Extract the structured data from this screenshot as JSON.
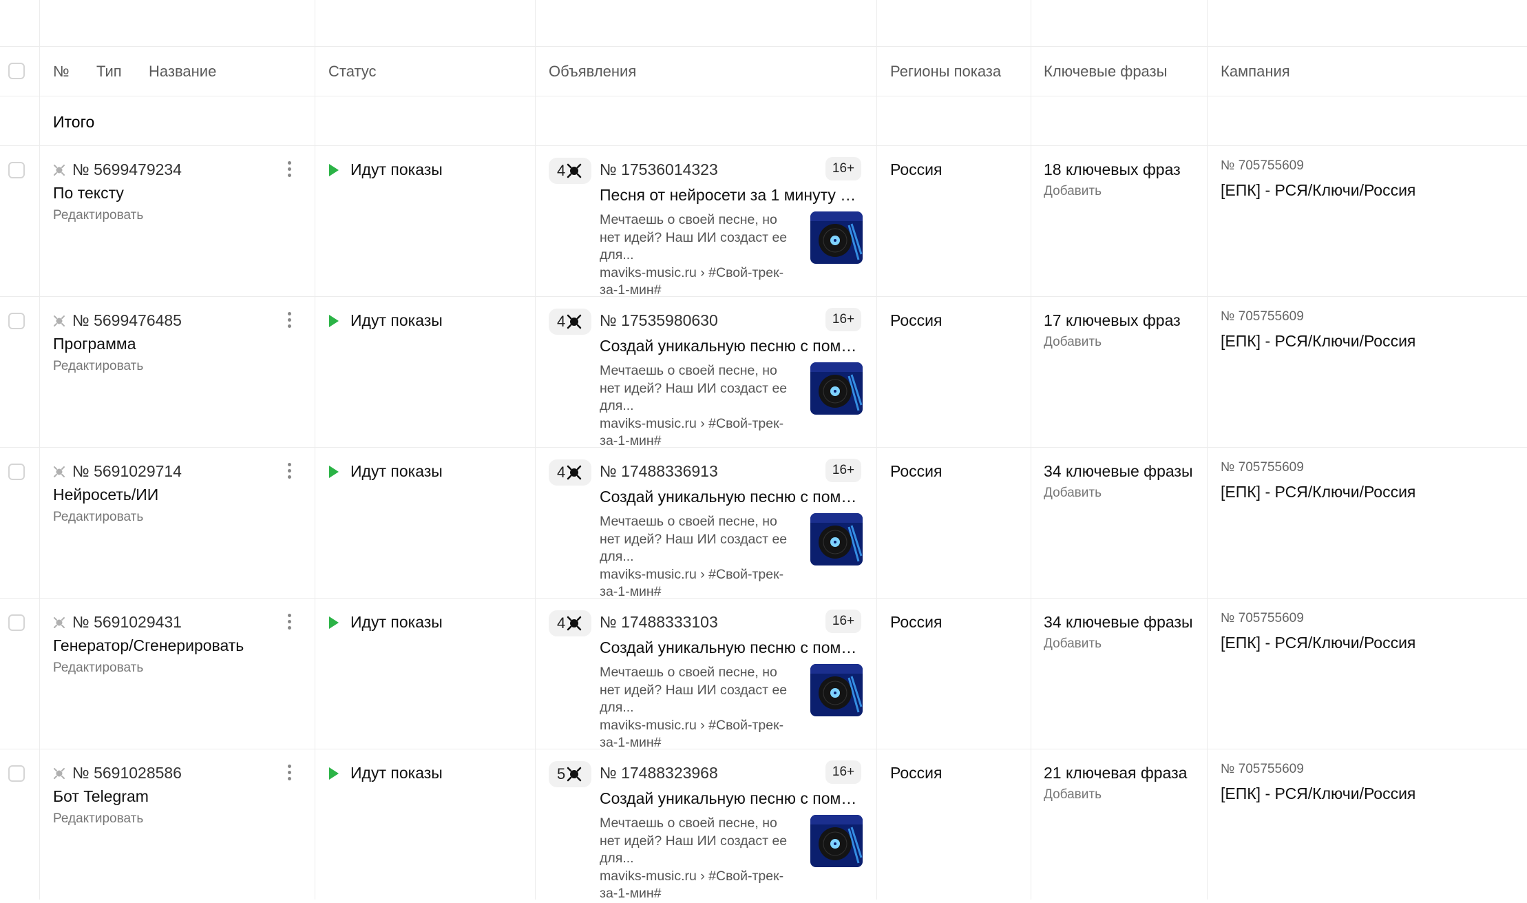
{
  "header": {
    "number": "№",
    "type": "Тип",
    "name": "Название",
    "status": "Статус",
    "ads": "Объявления",
    "regions": "Регионы показа",
    "keywords": "Ключевые фразы",
    "campaign": "Кампания"
  },
  "total_label": "Итого",
  "rows": [
    {
      "group_id": "№ 5699479234",
      "group_name": "По тексту",
      "edit_label": "Редактировать",
      "status": "Идут показы",
      "ad_count": "4",
      "ad_id": "№ 17536014323",
      "age": "16+",
      "ad_title": "Песня от нейросети за 1 минуту п...",
      "ad_desc": "Мечтаешь о своей песне, но нет идей? Наш ИИ создаст ее для...",
      "ad_link": "maviks-music.ru › #Свой-трек-за-1-мин#",
      "region": "Россия",
      "kw_count": "18 ключевых фраз",
      "kw_add": "Добавить",
      "campaign_id": "№ 705755609",
      "campaign_name": "[ЕПК] - РСЯ/Ключи/Россия"
    },
    {
      "group_id": "№ 5699476485",
      "group_name": "Программа",
      "edit_label": "Редактировать",
      "status": "Идут показы",
      "ad_count": "4",
      "ad_id": "№ 17535980630",
      "age": "16+",
      "ad_title": "Создай уникальную песню с помо...",
      "ad_desc": "Мечтаешь о своей песне, но нет идей? Наш ИИ создаст ее для...",
      "ad_link": "maviks-music.ru › #Свой-трек-за-1-мин#",
      "region": "Россия",
      "kw_count": "17 ключевых фраз",
      "kw_add": "Добавить",
      "campaign_id": "№ 705755609",
      "campaign_name": "[ЕПК] - РСЯ/Ключи/Россия"
    },
    {
      "group_id": "№ 5691029714",
      "group_name": "Нейросеть/ИИ",
      "edit_label": "Редактировать",
      "status": "Идут показы",
      "ad_count": "4",
      "ad_id": "№ 17488336913",
      "age": "16+",
      "ad_title": "Создай уникальную песню с помо...",
      "ad_desc": "Мечтаешь о своей песне, но нет идей? Наш ИИ создаст ее для...",
      "ad_link": "maviks-music.ru › #Свой-трек-за-1-мин#",
      "region": "Россия",
      "kw_count": "34 ключевые фразы",
      "kw_add": "Добавить",
      "campaign_id": "№ 705755609",
      "campaign_name": "[ЕПК] - РСЯ/Ключи/Россия"
    },
    {
      "group_id": "№ 5691029431",
      "group_name": "Генератор/Сгенерировать",
      "edit_label": "Редактировать",
      "status": "Идут показы",
      "ad_count": "4",
      "ad_id": "№ 17488333103",
      "age": "16+",
      "ad_title": "Создай уникальную песню с помо...",
      "ad_desc": "Мечтаешь о своей песне, но нет идей? Наш ИИ создаст ее для...",
      "ad_link": "maviks-music.ru › #Свой-трек-за-1-мин#",
      "region": "Россия",
      "kw_count": "34 ключевые фразы",
      "kw_add": "Добавить",
      "campaign_id": "№ 705755609",
      "campaign_name": "[ЕПК] - РСЯ/Ключи/Россия"
    },
    {
      "group_id": "№ 5691028586",
      "group_name": "Бот Telegram",
      "edit_label": "Редактировать",
      "status": "Идут показы",
      "ad_count": "5",
      "ad_id": "№ 17488323968",
      "age": "16+",
      "ad_title": "Создай уникальную песню с помо...",
      "ad_desc": "Мечтаешь о своей песне, но нет идей? Наш ИИ создаст ее для...",
      "ad_link": "maviks-music.ru › #Свой-трек-за-1-мин#",
      "region": "Россия",
      "kw_count": "21 ключевая фраза",
      "kw_add": "Добавить",
      "campaign_id": "№ 705755609",
      "campaign_name": "[ЕПК] - РСЯ/Ключи/Россия"
    }
  ]
}
